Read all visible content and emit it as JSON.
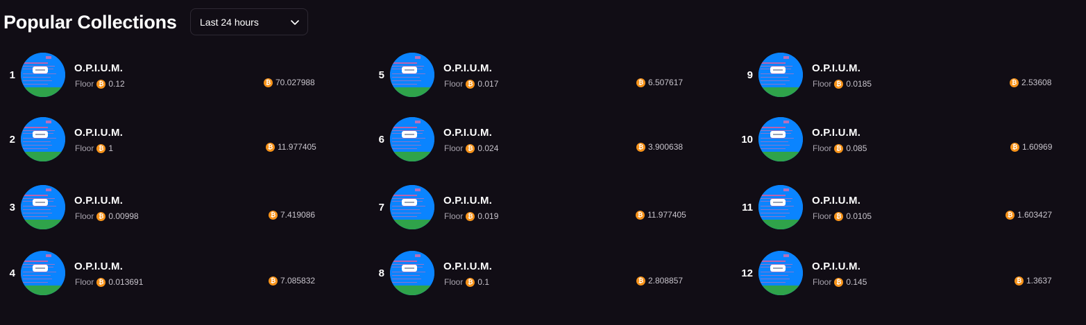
{
  "header": {
    "title": "Popular Collections",
    "timeframe": {
      "selected": "Last 24 hours"
    }
  },
  "coin_symbol": "₿",
  "floor_label": "Floor",
  "collections": [
    {
      "rank": "1",
      "name": "O.P.I.U.M.",
      "floor": "0.12",
      "volume": "70.027988"
    },
    {
      "rank": "2",
      "name": "O.P.I.U.M.",
      "floor": "1",
      "volume": "11.977405"
    },
    {
      "rank": "3",
      "name": "O.P.I.U.M.",
      "floor": "0.00998",
      "volume": "7.419086"
    },
    {
      "rank": "4",
      "name": "O.P.I.U.M.",
      "floor": "0.013691",
      "volume": "7.085832"
    },
    {
      "rank": "5",
      "name": "O.P.I.U.M.",
      "floor": "0.017",
      "volume": "6.507617"
    },
    {
      "rank": "6",
      "name": "O.P.I.U.M.",
      "floor": "0.024",
      "volume": "3.900638"
    },
    {
      "rank": "7",
      "name": "O.P.I.U.M.",
      "floor": "0.019",
      "volume": "11.977405"
    },
    {
      "rank": "8",
      "name": "O.P.I.U.M.",
      "floor": "0.1",
      "volume": "2.808857"
    },
    {
      "rank": "9",
      "name": "O.P.I.U.M.",
      "floor": "0.0185",
      "volume": "2.53608"
    },
    {
      "rank": "10",
      "name": "O.P.I.U.M.",
      "floor": "0.085",
      "volume": "1.60969"
    },
    {
      "rank": "11",
      "name": "O.P.I.U.M.",
      "floor": "0.0105",
      "volume": "1.603427"
    },
    {
      "rank": "12",
      "name": "O.P.I.U.M.",
      "floor": "0.145",
      "volume": "1.3637"
    }
  ],
  "colors": {
    "background": "#110d15",
    "coin": "#f7931a",
    "avatar_sky": "#0a84ff",
    "avatar_grass": "#2fa34a"
  },
  "icons": {
    "coin": "bitcoin-icon",
    "dropdown": "chevron-down-icon"
  }
}
